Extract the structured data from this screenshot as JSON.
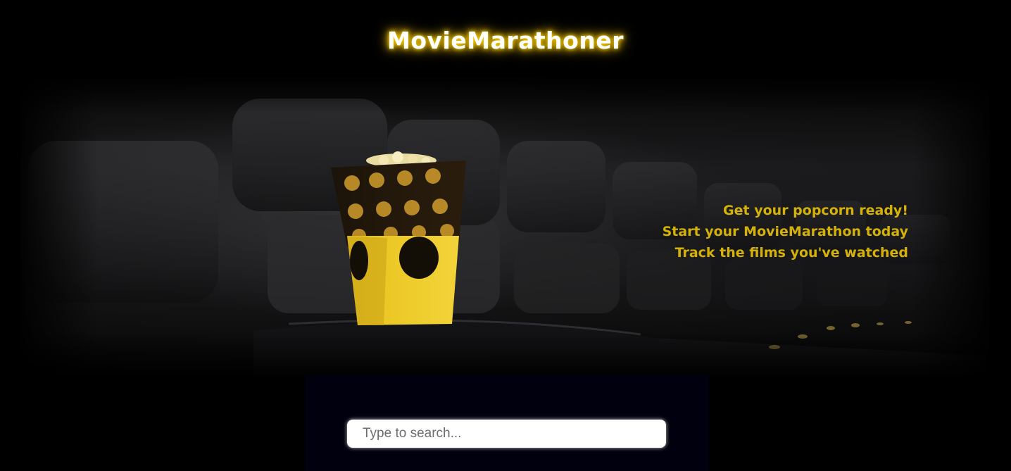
{
  "header": {
    "title": "MovieMarathoner"
  },
  "hero": {
    "image_description_icon": "cinema-seats-popcorn-image",
    "tagline_lines": [
      "Get your popcorn ready!",
      "Start your MovieMarathon today",
      "Track the films you've watched"
    ]
  },
  "search": {
    "placeholder": "Type to search...",
    "value": ""
  },
  "colors": {
    "background": "#000000",
    "title_glow": "#ffd400",
    "tagline": "#d4b20a",
    "search_panel": "#00000e"
  }
}
